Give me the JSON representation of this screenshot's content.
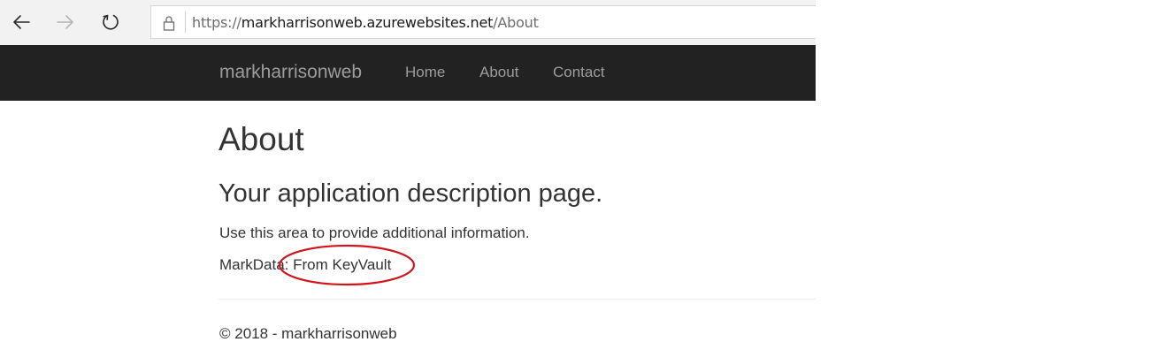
{
  "browser": {
    "back_icon": "arrow-left-icon",
    "forward_icon": "arrow-right-icon",
    "refresh_icon": "refresh-icon",
    "lock_icon": "lock-icon",
    "url_scheme": "https://",
    "url_host": "markharrisonweb.azurewebsites.net",
    "url_path": "/About"
  },
  "navbar": {
    "brand": "markharrisonweb",
    "links": [
      "Home",
      "About",
      "Contact"
    ]
  },
  "main": {
    "title": "About",
    "subtitle": "Your application description page.",
    "description": "Use this area to provide additional information.",
    "markdata_text": "MarkData: From KeyVault",
    "annotation_color": "#d0141e"
  },
  "footer": {
    "text": "© 2018 - markharrisonweb"
  },
  "colors": {
    "chrome_bg": "#f2f2f2",
    "navbar_bg": "#222222",
    "nav_link": "#9d9d9d",
    "text": "#333333"
  }
}
